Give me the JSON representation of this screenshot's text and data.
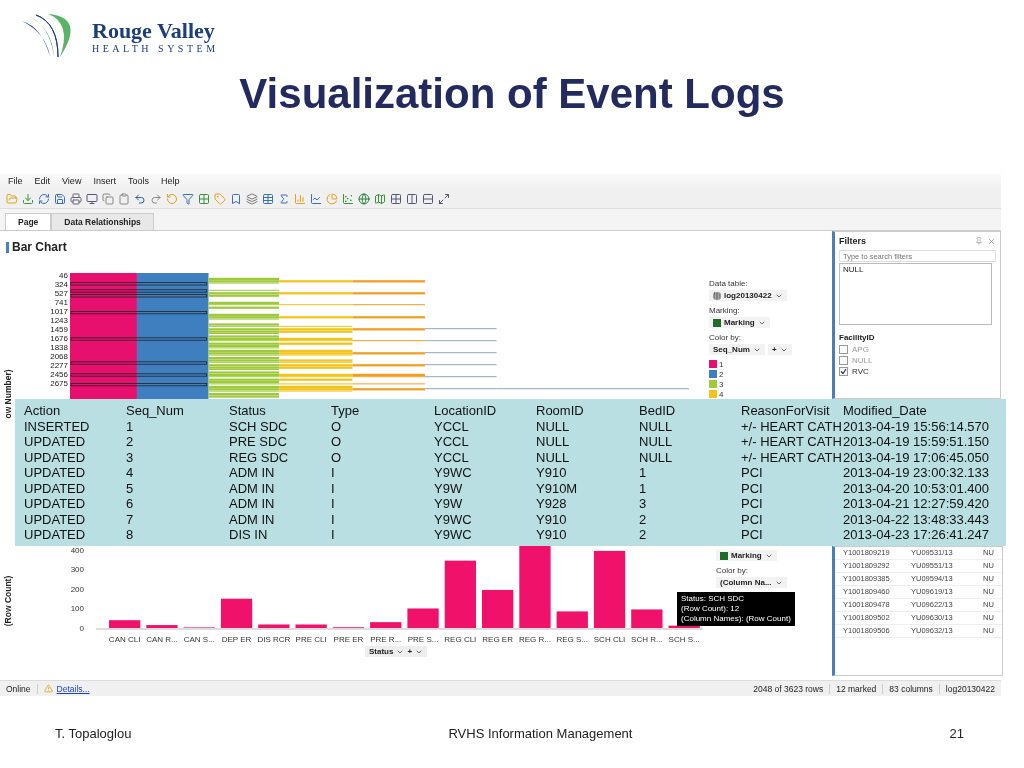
{
  "slide": {
    "logo": {
      "name": "Rouge Valley",
      "subtitle": "HEALTH SYSTEM"
    },
    "title": "Visualization of Event Logs",
    "footer": {
      "author": "T. Topaloglou",
      "center": "RVHS Information Management",
      "page": "21"
    }
  },
  "app": {
    "menu": [
      "File",
      "Edit",
      "View",
      "Insert",
      "Tools",
      "Help"
    ],
    "tabs": [
      {
        "label": "Page",
        "selected": true
      },
      {
        "label": "Data Relationships",
        "selected": false
      }
    ],
    "upper_visual": {
      "title": "Bar Chart",
      "axis_label": "ow Number)",
      "row_labels": [
        "46",
        "324",
        "527",
        "741",
        "1017",
        "1243",
        "1459",
        "1676",
        "1838",
        "2068",
        "2277",
        "2456",
        "2675"
      ],
      "legend": {
        "data_table_label": "Data table:",
        "data_table": "log20130422",
        "marking_label": "Marking:",
        "marking": "Marking",
        "color_by_label": "Color by:",
        "color_by": "Seq_Num",
        "plus": "+",
        "items": [
          {
            "label": "1",
            "color": "#e8106e"
          },
          {
            "label": "2",
            "color": "#3f7fc0"
          },
          {
            "label": "3",
            "color": "#9ec93a"
          },
          {
            "label": "4",
            "color": "#f2c318"
          }
        ]
      }
    },
    "filters": {
      "title": "Filters",
      "search_placeholder": "Type to search filters",
      "list": [
        "NULL"
      ],
      "facility": {
        "title": "FacilityID",
        "options": [
          {
            "label": "APG",
            "checked": false
          },
          {
            "label": "NULL",
            "checked": false
          },
          {
            "label": "RVC",
            "checked": true
          }
        ]
      }
    },
    "event_table": {
      "columns": [
        "Action",
        "Seq_Num",
        "Status",
        "Type",
        "LocationID",
        "RoomID",
        "BedID",
        "ReasonForVisit",
        "Modified_Date"
      ],
      "rows": [
        [
          "INSERTED",
          "1",
          "SCH SDC",
          "O",
          "YCCL",
          "NULL",
          "NULL",
          "+/- HEART CATH",
          "2013-04-19 15:56:14.570"
        ],
        [
          "UPDATED",
          "2",
          "PRE SDC",
          "O",
          "YCCL",
          "NULL",
          "NULL",
          "+/- HEART CATH",
          "2013-04-19 15:59:51.150"
        ],
        [
          "UPDATED",
          "3",
          "REG SDC",
          "O",
          "YCCL",
          "NULL",
          "NULL",
          "+/- HEART CATH",
          "2013-04-19 17:06:45.050"
        ],
        [
          "UPDATED",
          "4",
          "ADM IN",
          "I",
          "Y9WC",
          "Y910",
          "1",
          "PCI",
          "2013-04-19 23:00:32.133"
        ],
        [
          "UPDATED",
          "5",
          "ADM IN",
          "I",
          "Y9W",
          "Y910M",
          "1",
          "PCI",
          "2013-04-20 10:53:01.400"
        ],
        [
          "UPDATED",
          "6",
          "ADM IN",
          "I",
          "Y9W",
          "Y928",
          "3",
          "PCI",
          "2013-04-21 12:27:59.420"
        ],
        [
          "UPDATED",
          "7",
          "ADM IN",
          "I",
          "Y9WC",
          "Y910",
          "2",
          "PCI",
          "2013-04-22 13:48:33.443"
        ],
        [
          "UPDATED",
          "8",
          "DIS IN",
          "I",
          "Y9WC",
          "Y910",
          "2",
          "PCI",
          "2013-04-23 17:26:41.247"
        ]
      ]
    },
    "lower_visual": {
      "plus": "+",
      "chart_data": {
        "type": "bar",
        "xlabel": "Status",
        "ylabel": "(Row Count)",
        "categories": [
          "CAN CLI",
          "CAN R...",
          "CAN S...",
          "DEP ER",
          "DIS RCR",
          "PRE CLI",
          "PRE ER",
          "PRE R...",
          "PRE S...",
          "REG CLI",
          "REG ER",
          "REG R...",
          "REG S...",
          "SCH CLI",
          "SCH R...",
          "SCH S..."
        ],
        "series": [
          {
            "color": "#f0116a",
            "values": [
              40,
              15,
              3,
              150,
              18,
              18,
              4,
              30,
              100,
              345,
              195,
              420,
              85,
              395,
              95,
              12
            ]
          }
        ],
        "ylim": [
          0,
          420
        ],
        "yticks": [
          0,
          100,
          200,
          300,
          400
        ]
      },
      "legend": {
        "marking": "Marking",
        "color_by_label": "Color by:",
        "color_by": "(Column Na..."
      },
      "tooltip": [
        "Status: SCH SDC",
        "(Row Count): 12",
        "(Column Names): (Row Count)"
      ]
    },
    "details_table": {
      "rows": [
        [
          "Y1001809219",
          "YU09531/13",
          "NU"
        ],
        [
          "Y1001809292",
          "YU09551/13",
          "NU"
        ],
        [
          "Y1001809385",
          "YU09594/13",
          "NU"
        ],
        [
          "Y1001809460",
          "YU09619/13",
          "NU"
        ],
        [
          "Y1001809478",
          "YU09622/13",
          "NU"
        ],
        [
          "Y1001809502",
          "YU09630/13",
          "NU"
        ],
        [
          "Y1001809506",
          "YU09632/13",
          "NU"
        ]
      ]
    },
    "status_bar": {
      "online": "Online",
      "details": "Details...",
      "rows": "2048 of 3623 rows",
      "marked": "12 marked",
      "columns": "83 columns",
      "table": "log20130422"
    }
  }
}
